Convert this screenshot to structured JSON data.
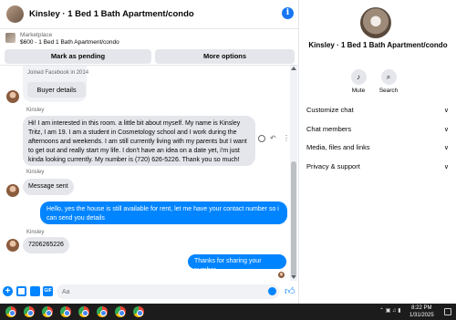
{
  "chat": {
    "title": "Kinsley · 1 Bed 1 Bath Apartment/condo",
    "info_icon": "info-icon"
  },
  "marketplace": {
    "label": "Marketplace",
    "listing": "$600 - 1 Bed 1 Bath Apartment/condo",
    "pending_button": "Mark as pending",
    "more_button": "More options"
  },
  "profile_card": {
    "joined": "Joined Facebook in 2014",
    "button": "Buyer details"
  },
  "messages": [
    {
      "sender": "Kinsley",
      "text": "Hi! I am interested in this room. a little bit about myself. My name is Kinsley Tritz, I am 19. I am a student in Cosmetology school and I work during the afternoons and weekends. I am still currently living with my parents but I want to get out and really start my life. I don't have an idea on a date yet, i'm just kinda looking currently. My number is (720) 626-5226. Thank you so much!"
    },
    {
      "sender": "Kinsley",
      "text": "Message sent"
    },
    {
      "text": "Hello, yes the house is still available for rent, let me have your contact number so i can send you  details"
    },
    {
      "sender": "Kinsley",
      "text": "7206265226"
    },
    {
      "text": "Thanks for sharing your number"
    }
  ],
  "composer": {
    "placeholder": "Aa"
  },
  "panel": {
    "title": "Kinsley · 1 Bed 1 Bath Apartment/condo",
    "mute_label": "Mute",
    "search_label": "Search",
    "sections": [
      "Customize chat",
      "Chat members",
      "Media, files and links",
      "Privacy & support"
    ]
  },
  "taskbar": {
    "time": "8:22 PM",
    "date": "1/31/2025"
  },
  "colors": {
    "accent": "#0084ff",
    "bubble_in": "#e4e6eb",
    "taskbar": "#1c1c1c"
  }
}
